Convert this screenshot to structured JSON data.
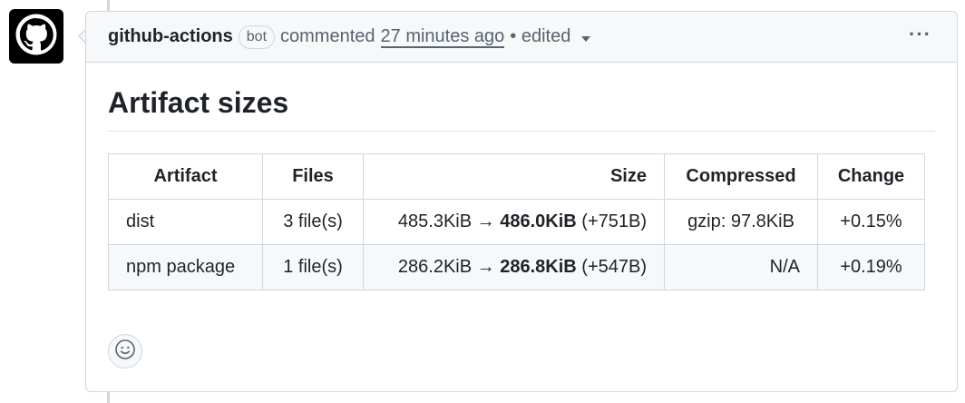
{
  "comment": {
    "author": "github-actions",
    "badge": "bot",
    "action": "commented",
    "time": "27 minutes ago",
    "edited": "• edited",
    "menu": "···"
  },
  "body": {
    "heading": "Artifact sizes",
    "table": {
      "headers": [
        "Artifact",
        "Files",
        "Size",
        "Compressed",
        "Change"
      ],
      "rows": [
        {
          "artifact": "dist",
          "files": "3 file(s)",
          "size_before": "485.3KiB →",
          "size_after": "486.0KiB",
          "size_delta": "(+751B)",
          "compressed": "gzip: 97.8KiB",
          "change": "+0.15%"
        },
        {
          "artifact": "npm package",
          "files": "1 file(s)",
          "size_before": "286.2KiB →",
          "size_after": "286.8KiB",
          "size_delta": "(+547B)",
          "compressed": "N/A",
          "change": "+0.19%"
        }
      ]
    }
  },
  "icons": {
    "avatar": "github-logo-icon",
    "reaction": "smiley-icon",
    "menu": "kebab-icon",
    "dropdown": "triangle-down-icon"
  },
  "colors": {
    "border": "#d0d7de",
    "header_bg": "#f6f8fa",
    "muted_text": "#59636e",
    "text": "#1f2328"
  }
}
